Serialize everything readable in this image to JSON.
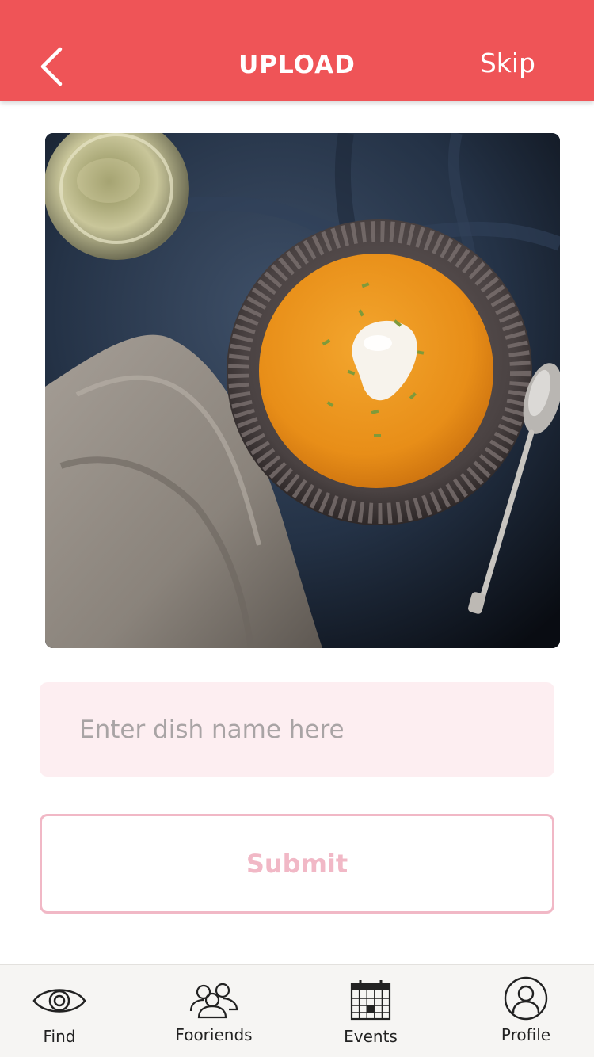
{
  "header": {
    "title": "UPLOAD",
    "skip_label": "Skip",
    "back_icon": "chevron-left-icon",
    "background": "#ef5457"
  },
  "photo": {
    "description_icon": "dish-photo"
  },
  "form": {
    "dish_name_value": "",
    "dish_name_placeholder": "Enter dish name here",
    "submit_label": "Submit"
  },
  "tabbar": {
    "items": [
      {
        "label": "Find",
        "icon": "eye-icon"
      },
      {
        "label": "Fooriends",
        "icon": "group-icon"
      },
      {
        "label": "Events",
        "icon": "calendar-icon"
      },
      {
        "label": "Profile",
        "icon": "user-circle-icon"
      }
    ]
  },
  "colors": {
    "accent": "#ef5457",
    "input_bg": "#fdeef1",
    "submit_border": "#f1b8c6",
    "tabbar_bg": "#f6f5f3"
  }
}
